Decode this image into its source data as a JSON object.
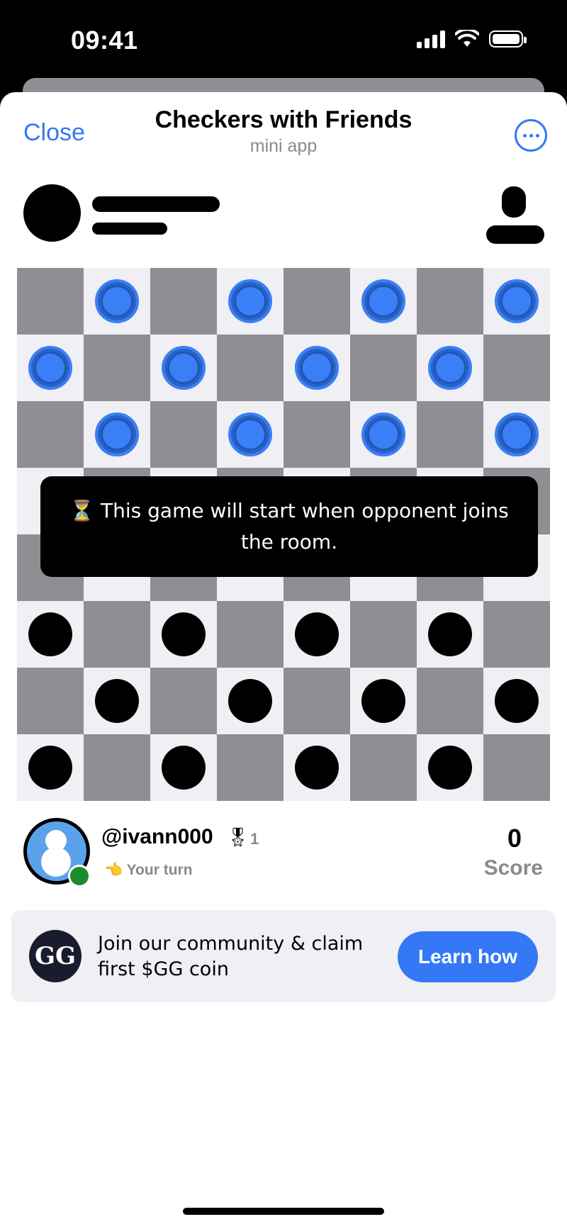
{
  "status_bar": {
    "time": "09:41"
  },
  "nav": {
    "close_label": "Close",
    "title": "Checkers with Friends",
    "subtitle": "mini app"
  },
  "board": {
    "rows": [
      [
        "",
        "blue",
        "",
        "blue",
        "",
        "blue",
        "",
        "blue"
      ],
      [
        "blue",
        "",
        "blue",
        "",
        "blue",
        "",
        "blue",
        ""
      ],
      [
        "",
        "blue",
        "",
        "blue",
        "",
        "blue",
        "",
        "blue"
      ],
      [
        "",
        "",
        "",
        "",
        "",
        "",
        "",
        ""
      ],
      [
        "",
        "",
        "",
        "",
        "",
        "",
        "",
        ""
      ],
      [
        "black",
        "",
        "black",
        "",
        "black",
        "",
        "black",
        ""
      ],
      [
        "",
        "black",
        "",
        "black",
        "",
        "black",
        "",
        "black"
      ],
      [
        "black",
        "",
        "black",
        "",
        "black",
        "",
        "black",
        ""
      ]
    ],
    "colors": {
      "light": "#efeff4",
      "dark": "#8e8e93",
      "blue_piece": "#3a7ff6",
      "black_piece": "#000000"
    }
  },
  "overlay": {
    "message": "⏳ This game will start when opponent joins the room."
  },
  "player": {
    "username": "@ivann000",
    "medal_icon": "🎖",
    "medal_count": "1",
    "turn_text": "👈 Your turn",
    "score_value": "0",
    "score_label": "Score"
  },
  "banner": {
    "logo_text": "GG",
    "text": "Join our community & claim first $GG coin",
    "button_label": "Learn how"
  },
  "accent_color": "#3478f6"
}
